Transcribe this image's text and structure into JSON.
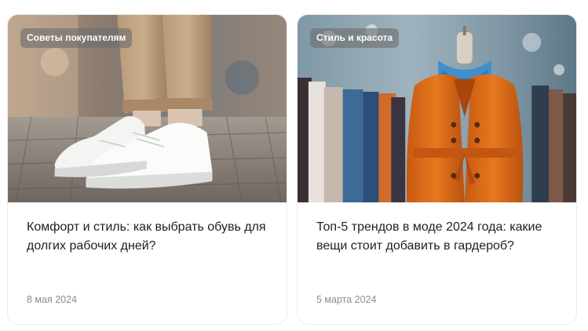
{
  "articles": [
    {
      "category": "Советы покупателям",
      "title": "Комфорт и стиль: как выбрать обувь для долгих рабочих дней?",
      "date": "8 мая 2024",
      "image": "white-sneakers-photo"
    },
    {
      "category": "Стиль и красота",
      "title": "Топ-5 трендов в моде 2024 года: какие вещи стоит добавить в гардероб?",
      "date": "5 марта 2024",
      "image": "orange-coat-mannequin-photo"
    }
  ]
}
